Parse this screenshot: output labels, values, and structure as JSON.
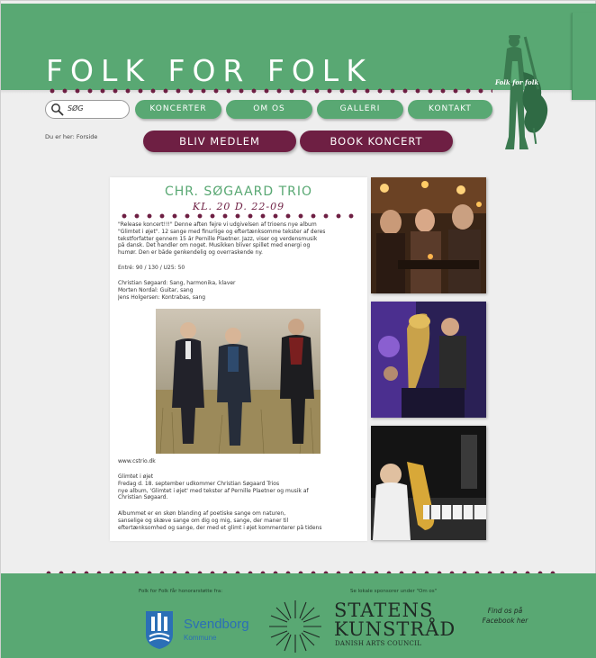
{
  "site": {
    "logo": "FOLK FOR FOLK",
    "figure_label": "Folk for folk"
  },
  "search": {
    "label": "SØG"
  },
  "nav": [
    {
      "label": "KONCERTER"
    },
    {
      "label": "OM OS"
    },
    {
      "label": "GALLERI"
    },
    {
      "label": "KONTAKT"
    }
  ],
  "breadcrumb": "Du er her: Forside",
  "actions": {
    "member_label": "BLIV MEDLEM",
    "book_label": "BOOK KONCERT"
  },
  "article": {
    "title": "CHR. SØGAARD TRIO",
    "date": "KL. 20 D. 22-09",
    "intro": [
      "\"Release koncert!!!\" Denne aften fejre vi udgivelsen af trioens nye album",
      "\"Glimtet i øjet\". 12 sange med finurlige og eftertænksomme tekster af deres",
      "tekstforfatter gennem 15 år Pernille Plaetner. Jazz, viser og verdensmusik",
      "på dansk. Det handler om noget. Musikken bliver spillet med energi og",
      "humør. Den er både genkendelig og overraskende ny."
    ],
    "entry": "Entré: 90 / 130 / U25: 50",
    "members": [
      "Christian Søgaard: Sang, harmonika, klaver",
      "Morten Nordal: Guitar, sang",
      "Jens Holgersen: Kontrabas, sang"
    ],
    "website": "www.cstrio.dk",
    "album_lines": [
      "Glimtet i øjet",
      "Fredag d. 18. september udkommer Christian Søgaard Trios",
      "nye album, 'Glimtet i øjet' med tekster af Pernille Plaetner og musik af",
      "Christian Søgaard."
    ],
    "album_desc": [
      "Albummet er en skøn blanding af poetiske sange om naturen,",
      "sanselige og skæve sange om dig og mig, sange, der maner til",
      "eftertænksomhed og sange, der med et glimt i øjet kommenterer på tidens"
    ]
  },
  "footer": {
    "support_caption": "Folk for Folk får honorarstøtte fra:",
    "sponsor_caption": "Se lokale sponsorer under \"Om os\"",
    "svendborg": "Svendborg",
    "svendborg_sub": "Kommune",
    "statens_line1": "STATENS",
    "statens_line2": "KUNSTRÅD",
    "statens_sub": "DANISH ARTS COUNCIL",
    "find_us": "Find os på Facebook her"
  },
  "colors": {
    "green": "#59a873",
    "maroon": "#6e1f43",
    "background": "#eeeeee"
  }
}
